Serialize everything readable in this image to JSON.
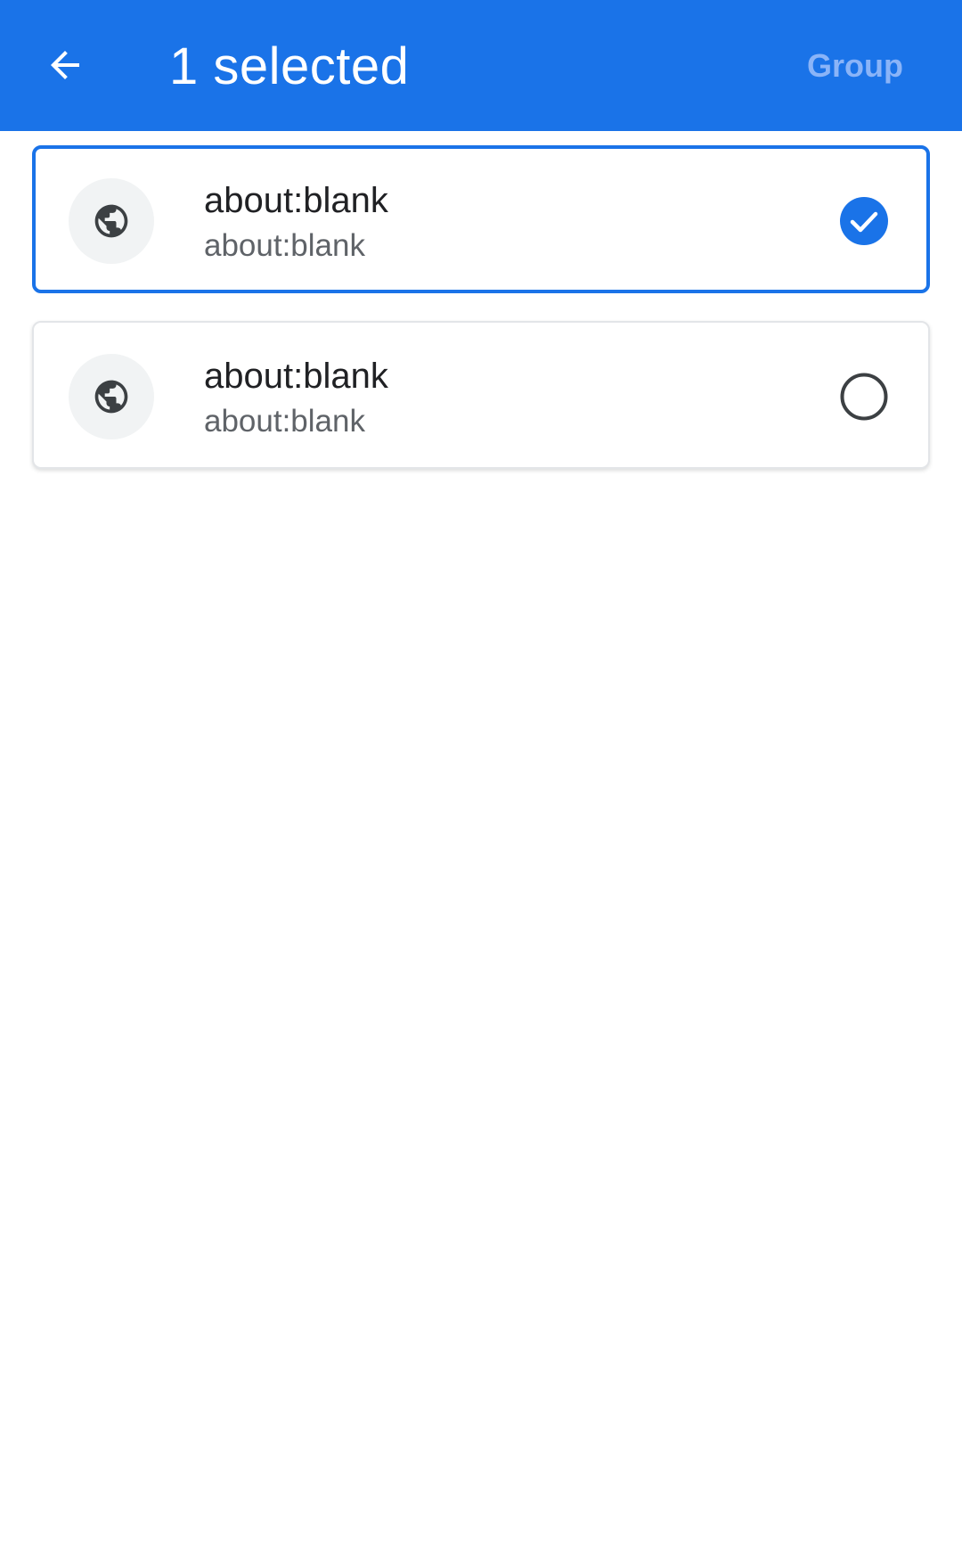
{
  "toolbar": {
    "title": "1 selected",
    "group_label": "Group",
    "back_icon": "arrow-back-icon"
  },
  "tabs": [
    {
      "title": "about:blank",
      "url": "about:blank",
      "icon": "globe-icon",
      "selected": true
    },
    {
      "title": "about:blank",
      "url": "about:blank",
      "icon": "globe-icon",
      "selected": false
    }
  ],
  "colors": {
    "accent": "#1a73e8",
    "toolbar_text": "#ffffff",
    "group_disabled": "#8ab4f8",
    "title_text": "#202124",
    "url_text": "#5f6368",
    "favicon_bg": "#f1f3f4",
    "icon": "#3c4043"
  }
}
